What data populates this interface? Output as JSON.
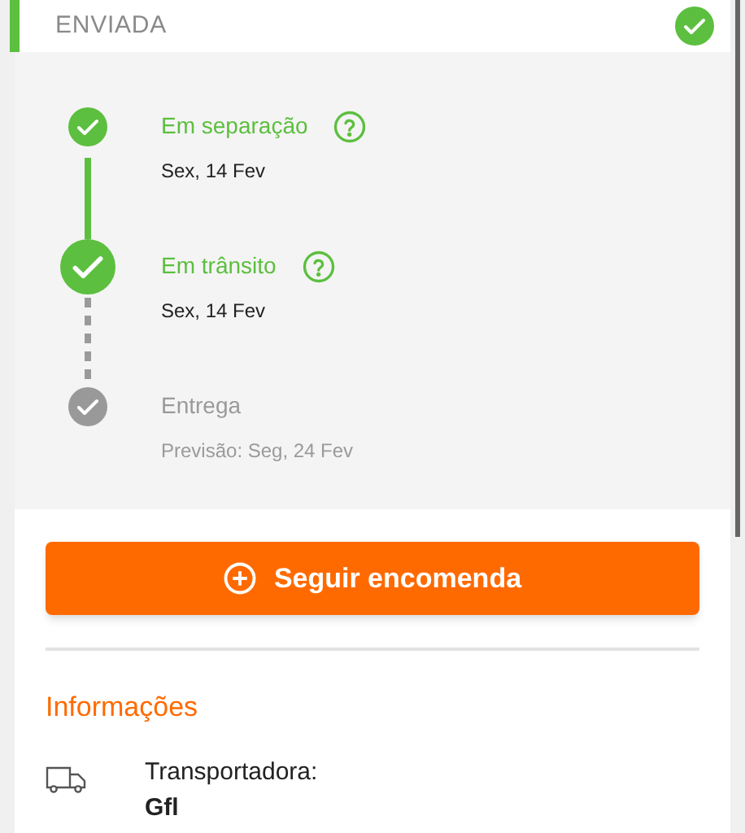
{
  "status_header": {
    "label": "ENVIADA",
    "completed": true
  },
  "steps": [
    {
      "title": "Em separação",
      "date": "Sex, 14 Fev",
      "kind": "done",
      "help": true
    },
    {
      "title": "Em trânsito",
      "date": "Sex, 14 Fev",
      "kind": "current",
      "help": true
    },
    {
      "title": "Entrega",
      "date": "Previsão: Seg, 24 Fev",
      "kind": "pending",
      "help": false
    }
  ],
  "track_button": {
    "label": "Seguir encomenda"
  },
  "info": {
    "title": "Informações",
    "items": [
      {
        "label": "Transportadora:",
        "value": "Gfl"
      }
    ]
  }
}
